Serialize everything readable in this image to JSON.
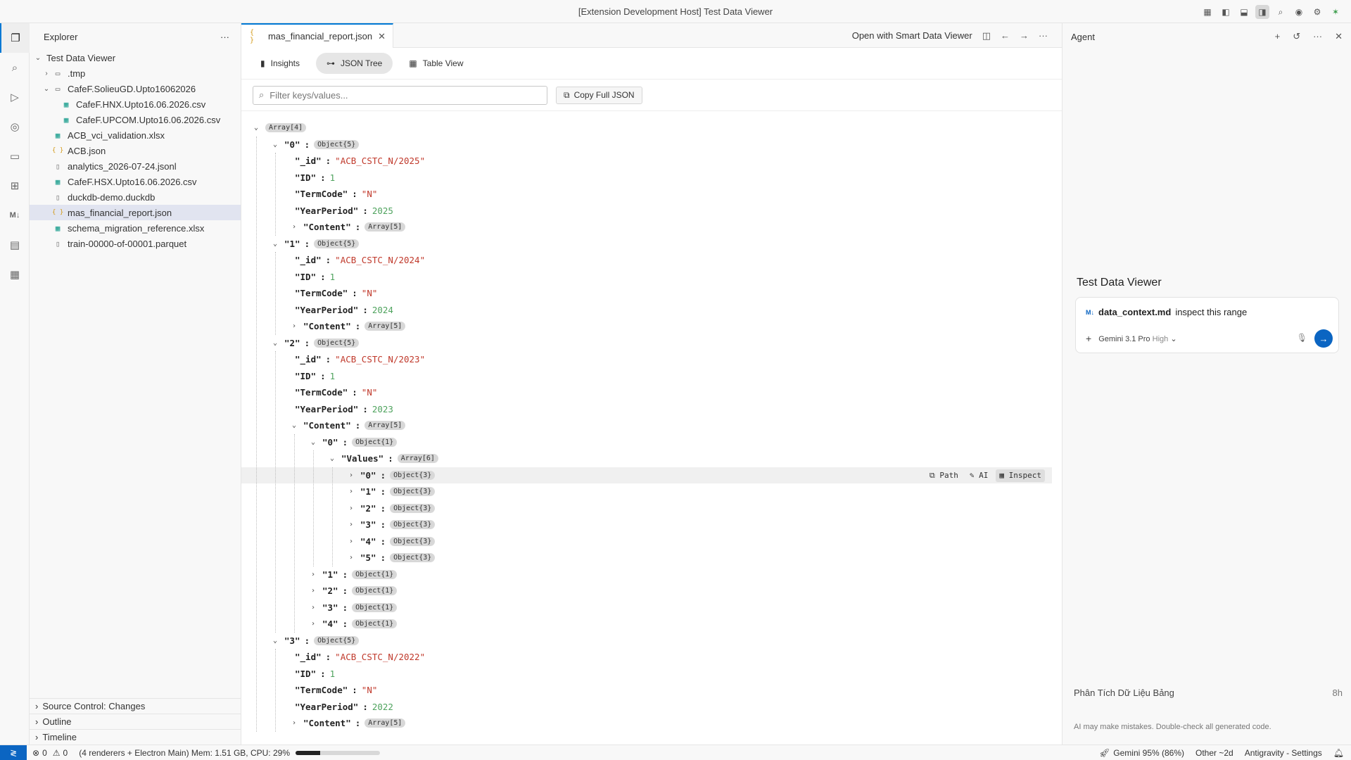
{
  "window": {
    "title": "[Extension Development Host] Test Data Viewer"
  },
  "titlebar_icons": [
    "layout-icon",
    "sidebar-left-icon",
    "panel-bottom-icon",
    "sidebar-right-icon",
    "search-icon",
    "chrome-icon",
    "gear-icon",
    "agent-icon"
  ],
  "activitybar": [
    "files-icon",
    "search-icon",
    "run-debug-icon",
    "remote-icon",
    "remote-explorer-icon",
    "extensions-icon",
    "markdown-icon",
    "book-icon",
    "table-icon"
  ],
  "sidebar": {
    "title": "Explorer",
    "root": "Test Data Viewer",
    "items": [
      {
        "label": ".tmp",
        "type": "folder",
        "depth": 1,
        "chev": "closed"
      },
      {
        "label": "CafeF.SolieuGD.Upto16062026",
        "type": "folder",
        "depth": 1,
        "chev": "open"
      },
      {
        "label": "CafeF.HNX.Upto16.06.2026.csv",
        "type": "csv",
        "depth": 2
      },
      {
        "label": "CafeF.UPCOM.Upto16.06.2026.csv",
        "type": "csv",
        "depth": 2
      },
      {
        "label": "ACB_vci_validation.xlsx",
        "type": "csv",
        "depth": 1
      },
      {
        "label": "ACB.json",
        "type": "json",
        "depth": 1
      },
      {
        "label": "analytics_2026-07-24.jsonl",
        "type": "file",
        "depth": 1
      },
      {
        "label": "CafeF.HSX.Upto16.06.2026.csv",
        "type": "csv",
        "depth": 1
      },
      {
        "label": "duckdb-demo.duckdb",
        "type": "file",
        "depth": 1
      },
      {
        "label": "mas_financial_report.json",
        "type": "json",
        "depth": 1,
        "selected": true
      },
      {
        "label": "schema_migration_reference.xlsx",
        "type": "csv",
        "depth": 1
      },
      {
        "label": "train-00000-of-00001.parquet",
        "type": "file",
        "depth": 1
      }
    ],
    "sections": [
      "Source Control: Changes",
      "Outline",
      "Timeline"
    ]
  },
  "editor": {
    "tab": {
      "icon": "{ }",
      "label": "mas_financial_report.json"
    },
    "open_with": "Open with Smart Data Viewer",
    "view_tabs": [
      {
        "label": "Insights",
        "icon": "chart-icon"
      },
      {
        "label": "JSON Tree",
        "icon": "tree-icon",
        "active": true
      },
      {
        "label": "Table View",
        "icon": "table-icon"
      }
    ],
    "filter_placeholder": "Filter keys/values...",
    "copy_label": "Copy Full JSON",
    "row_actions": {
      "path": "Path",
      "ai": "AI",
      "inspect": "Inspect"
    },
    "tree": [
      {
        "d": 0,
        "chev": "open",
        "badge": "Array[4]"
      },
      {
        "d": 1,
        "chev": "open",
        "key": "\"0\"",
        "badge": "Object{5}"
      },
      {
        "d": 2,
        "key": "\"_id\"",
        "str": "\"ACB_CSTC_N/2025\""
      },
      {
        "d": 2,
        "key": "\"ID\"",
        "num": "1"
      },
      {
        "d": 2,
        "key": "\"TermCode\"",
        "str": "\"N\""
      },
      {
        "d": 2,
        "key": "\"YearPeriod\"",
        "num": "2025"
      },
      {
        "d": 2,
        "chev": "closed",
        "key": "\"Content\"",
        "badge": "Array[5]"
      },
      {
        "d": 1,
        "chev": "open",
        "key": "\"1\"",
        "badge": "Object{5}"
      },
      {
        "d": 2,
        "key": "\"_id\"",
        "str": "\"ACB_CSTC_N/2024\""
      },
      {
        "d": 2,
        "key": "\"ID\"",
        "num": "1"
      },
      {
        "d": 2,
        "key": "\"TermCode\"",
        "str": "\"N\""
      },
      {
        "d": 2,
        "key": "\"YearPeriod\"",
        "num": "2024"
      },
      {
        "d": 2,
        "chev": "closed",
        "key": "\"Content\"",
        "badge": "Array[5]"
      },
      {
        "d": 1,
        "chev": "open",
        "key": "\"2\"",
        "badge": "Object{5}"
      },
      {
        "d": 2,
        "key": "\"_id\"",
        "str": "\"ACB_CSTC_N/2023\""
      },
      {
        "d": 2,
        "key": "\"ID\"",
        "num": "1"
      },
      {
        "d": 2,
        "key": "\"TermCode\"",
        "str": "\"N\""
      },
      {
        "d": 2,
        "key": "\"YearPeriod\"",
        "num": "2023"
      },
      {
        "d": 2,
        "chev": "open",
        "key": "\"Content\"",
        "badge": "Array[5]"
      },
      {
        "d": 3,
        "chev": "open",
        "key": "\"0\"",
        "badge": "Object{1}"
      },
      {
        "d": 4,
        "chev": "open",
        "key": "\"Values\"",
        "badge": "Array[6]"
      },
      {
        "d": 5,
        "chev": "closed",
        "key": "\"0\"",
        "badge": "Object{3}",
        "hl": true
      },
      {
        "d": 5,
        "chev": "closed",
        "key": "\"1\"",
        "badge": "Object{3}"
      },
      {
        "d": 5,
        "chev": "closed",
        "key": "\"2\"",
        "badge": "Object{3}"
      },
      {
        "d": 5,
        "chev": "closed",
        "key": "\"3\"",
        "badge": "Object{3}"
      },
      {
        "d": 5,
        "chev": "closed",
        "key": "\"4\"",
        "badge": "Object{3}"
      },
      {
        "d": 5,
        "chev": "closed",
        "key": "\"5\"",
        "badge": "Object{3}"
      },
      {
        "d": 3,
        "chev": "closed",
        "key": "\"1\"",
        "badge": "Object{1}"
      },
      {
        "d": 3,
        "chev": "closed",
        "key": "\"2\"",
        "badge": "Object{1}"
      },
      {
        "d": 3,
        "chev": "closed",
        "key": "\"3\"",
        "badge": "Object{1}"
      },
      {
        "d": 3,
        "chev": "closed",
        "key": "\"4\"",
        "badge": "Object{1}"
      },
      {
        "d": 1,
        "chev": "open",
        "key": "\"3\"",
        "badge": "Object{5}"
      },
      {
        "d": 2,
        "key": "\"_id\"",
        "str": "\"ACB_CSTC_N/2022\""
      },
      {
        "d": 2,
        "key": "\"ID\"",
        "num": "1"
      },
      {
        "d": 2,
        "key": "\"TermCode\"",
        "str": "\"N\""
      },
      {
        "d": 2,
        "key": "\"YearPeriod\"",
        "num": "2022"
      },
      {
        "d": 2,
        "chev": "closed",
        "key": "\"Content\"",
        "badge": "Array[5]"
      }
    ]
  },
  "agent": {
    "header": "Agent",
    "title": "Test Data Viewer",
    "context_file": "data_context.md",
    "prompt": "inspect this range",
    "model": "Gemini 3.1 Pro",
    "effort": "High",
    "history_item": "Phân Tích Dữ Liệu Bảng",
    "history_time": "8h",
    "disclaimer": "AI may make mistakes. Double-check all generated code."
  },
  "statusbar": {
    "errors": "0",
    "warnings": "0",
    "memory": "(4 renderers + Electron Main) Mem: 1.51 GB, CPU: 29%",
    "memory_fraction": 0.29,
    "gemini": "Gemini 95% (86%)",
    "other": "Other ~2d",
    "settings": "Antigravity - Settings"
  }
}
